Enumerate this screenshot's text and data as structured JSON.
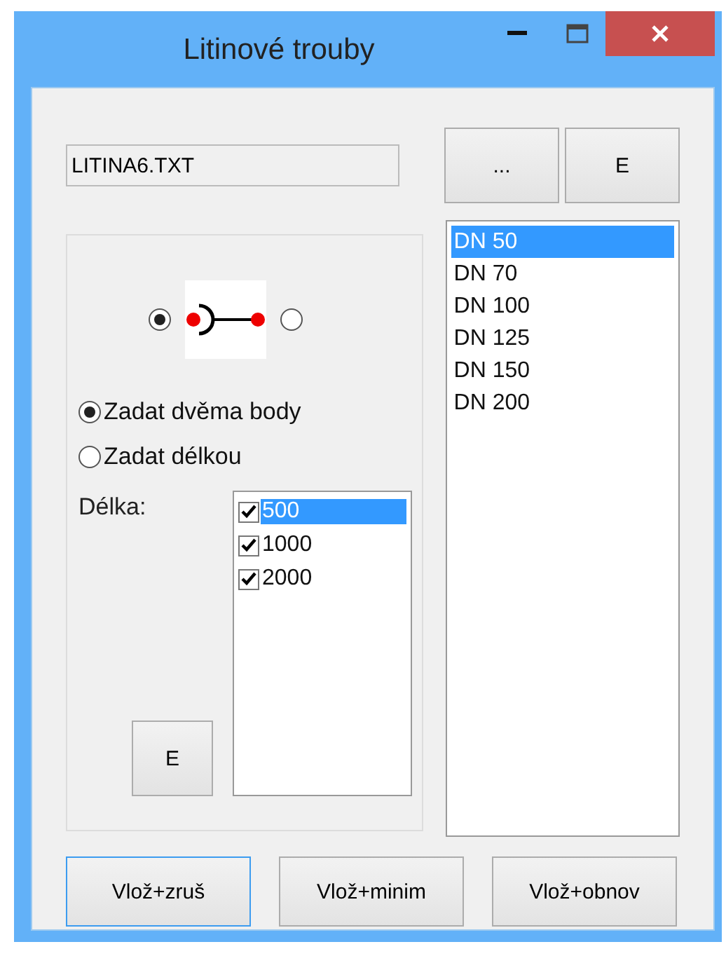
{
  "window": {
    "title": "Litinové trouby"
  },
  "file_field": {
    "value": "LITINA6.TXT"
  },
  "top_buttons": [
    "...",
    "E"
  ],
  "end_type": [
    {
      "selected": true
    },
    {
      "selected": false
    }
  ],
  "input_mode": [
    {
      "label": "Zadat dvěma body",
      "selected": true
    },
    {
      "label": "Zadat délkou",
      "selected": false
    }
  ],
  "length_label": "Délka:",
  "lengths": [
    {
      "label": "500",
      "checked": true,
      "selected": true
    },
    {
      "label": "1000",
      "checked": true,
      "selected": false
    },
    {
      "label": "2000",
      "checked": true,
      "selected": false
    }
  ],
  "length_edit_button": "E",
  "diameters": [
    {
      "label": "DN 50",
      "selected": true
    },
    {
      "label": "DN 70",
      "selected": false
    },
    {
      "label": "DN 100",
      "selected": false
    },
    {
      "label": "DN 125",
      "selected": false
    },
    {
      "label": "DN 150",
      "selected": false
    },
    {
      "label": "DN 200",
      "selected": false
    }
  ],
  "bottom_buttons": [
    {
      "label": "Vlož+zruš",
      "focused": true
    },
    {
      "label": "Vlož+minim",
      "focused": false
    },
    {
      "label": "Vlož+obnov",
      "focused": false
    }
  ]
}
